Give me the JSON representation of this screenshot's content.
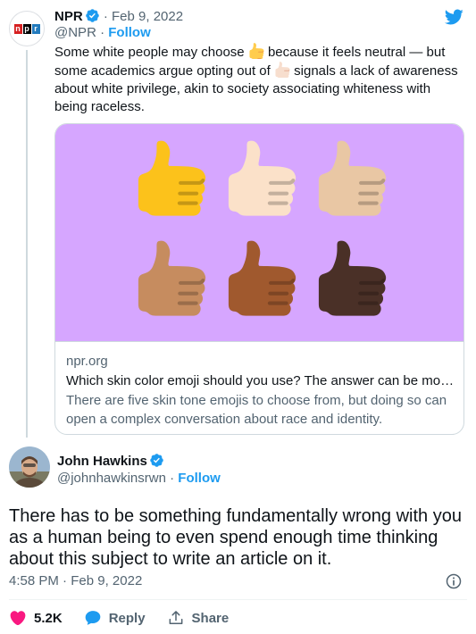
{
  "quoted_tweet": {
    "author_name": "NPR",
    "date_separator": "·",
    "date": "Feb 9, 2022",
    "handle": "@NPR",
    "handle_separator": " · ",
    "follow_label": "Follow",
    "text_parts": [
      "Some white people may choose ",
      " because it feels neutral — but some academics argue opting out of ",
      " signals a lack of awareness about white privilege, akin to society associating whiteness with being raceless."
    ],
    "avatar_logo_letters": [
      "n",
      "p",
      "r"
    ],
    "card": {
      "domain": "npr.org",
      "title": "Which skin color emoji should you use? The answer can be mor...",
      "description": "There are five skin tone emojis to choose from, but doing so can open a complex conversation about race and identity.",
      "thumb_colors": [
        "#fcc21b",
        "#fbe1c9",
        "#e9c7a4",
        "#c68c5f",
        "#a0592e",
        "#4a3027"
      ]
    }
  },
  "main_tweet": {
    "author_name": "John Hawkins",
    "handle": "@johnhawkinsrwn",
    "handle_separator": " · ",
    "follow_label": "Follow",
    "text": "There has to be something fundamentally wrong with you as a human being to even spend enough time thinking about this subject to write an article on it.",
    "time": "4:58 PM",
    "date_separator": " · ",
    "date": "Feb 9, 2022",
    "like_count": "5.2K",
    "reply_label": "Reply",
    "share_label": "Share"
  },
  "colors": {
    "link_blue": "#1d9bf0",
    "like_pink": "#f91880",
    "card_background": "#d6a6ff",
    "npr_red": "#d62021",
    "npr_blue": "#237bbd"
  },
  "icons": [
    "npr-logo",
    "verified-badge-icon",
    "twitter-bird-icon",
    "thumbs-up-emoji",
    "info-icon",
    "heart-icon",
    "reply-bubble-icon",
    "share-icon"
  ]
}
